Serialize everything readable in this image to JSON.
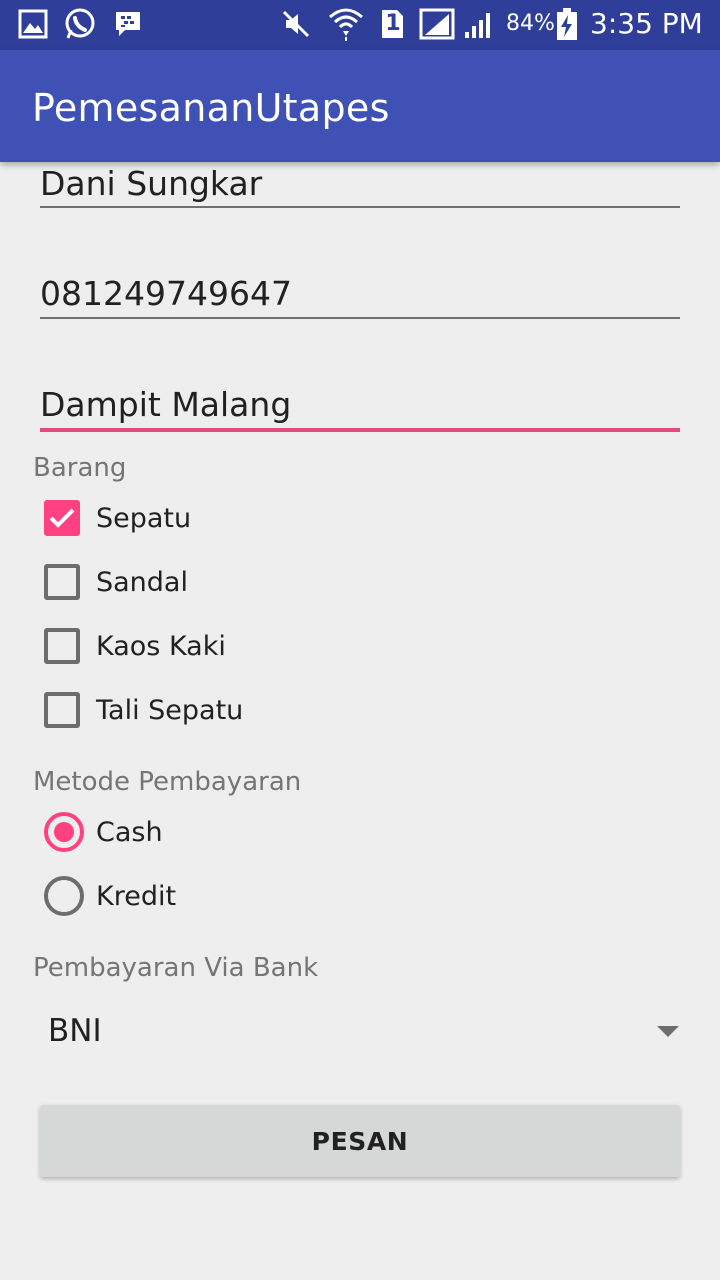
{
  "status_bar": {
    "battery": "84%",
    "time": "3:35 PM",
    "sim_slot": "1",
    "icons": [
      "gallery-icon",
      "whatsapp-icon",
      "bbm-icon",
      "mute-icon",
      "wifi-icon",
      "sim-icon",
      "signal-icon",
      "signal-icon",
      "battery-charging-icon"
    ]
  },
  "app_bar": {
    "title": "PemesananUtapes"
  },
  "form": {
    "name": "Dani Sungkar",
    "phone": "081249749647",
    "address": "Dampit Malang",
    "barang_label": "Barang",
    "items": [
      {
        "label": "Sepatu",
        "checked": true
      },
      {
        "label": "Sandal",
        "checked": false
      },
      {
        "label": "Kaos Kaki",
        "checked": false
      },
      {
        "label": "Tali Sepatu",
        "checked": false
      }
    ],
    "payment_label": "Metode Pembayaran",
    "payments": [
      {
        "label": "Cash",
        "selected": true
      },
      {
        "label": "Kredit",
        "selected": false
      }
    ],
    "bank_label": "Pembayaran Via Bank",
    "bank_selected": "BNI",
    "submit_label": "PESAN"
  },
  "colors": {
    "primary": "#3f51b5",
    "primary_dark": "#2f3e99",
    "accent": "#ff4081",
    "background": "#eeeeee"
  }
}
